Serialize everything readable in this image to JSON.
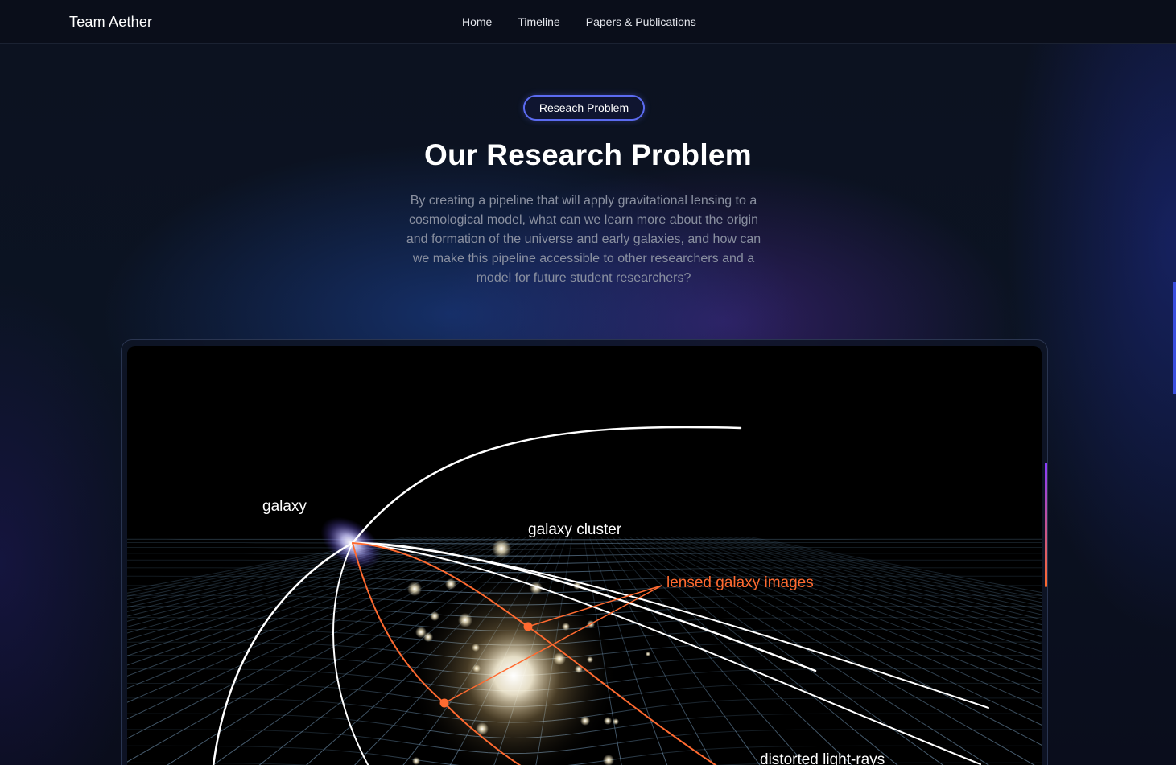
{
  "navbar": {
    "brand": "Team Aether",
    "links": [
      {
        "label": "Home"
      },
      {
        "label": "Timeline"
      },
      {
        "label": "Papers & Publications"
      }
    ]
  },
  "section": {
    "badge": "Reseach Problem",
    "title": "Our Research Problem",
    "description": "By creating a pipeline that will apply gravitational lensing to a cosmological model, what can we learn more about the origin and formation of the universe and early galaxies, and how can we make this pipeline accessible to other researchers and a model for future student researchers?"
  },
  "diagram": {
    "labels": {
      "galaxy": "galaxy",
      "galaxy_cluster": "galaxy cluster",
      "lensed_images": "lensed galaxy images",
      "distorted_rays": "distorted light-rays"
    }
  },
  "colors": {
    "accent_pill": "#5b6bf0",
    "lensed": "#ff6a30",
    "background": "#0a0d18"
  }
}
